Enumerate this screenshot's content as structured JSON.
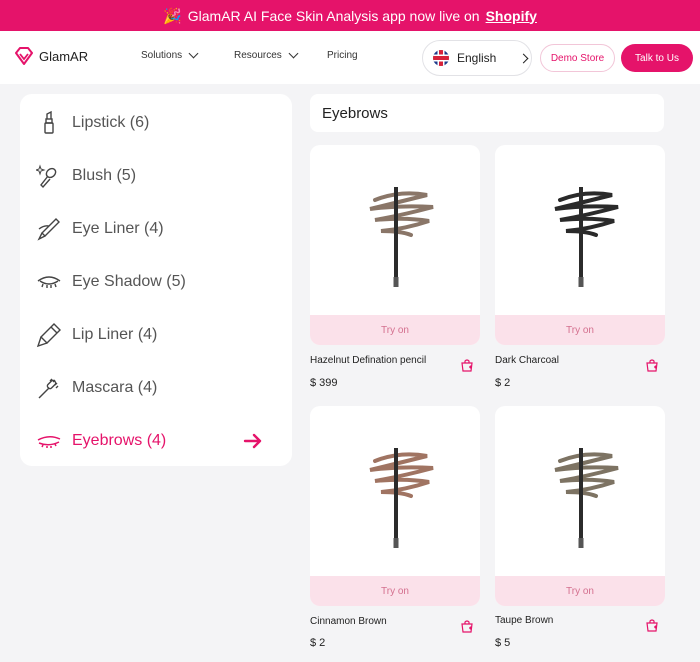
{
  "banner": {
    "text": "GlamAR AI Face Skin Analysis app now live on",
    "link": "Shopify",
    "icon": "party-popper-icon"
  },
  "nav": {
    "logo": "GlamAR",
    "solutions": "Solutions",
    "resources": "Resources",
    "pricing": "Pricing",
    "language": "English",
    "demo_store": "Demo Store",
    "talk": "Talk to Us"
  },
  "sidebar": {
    "items": [
      {
        "label": "Lipstick (6)",
        "icon": "lipstick-icon"
      },
      {
        "label": "Blush (5)",
        "icon": "blush-icon"
      },
      {
        "label": "Eye Liner (4)",
        "icon": "eyeliner-icon"
      },
      {
        "label": "Eye Shadow (5)",
        "icon": "eyeshadow-icon"
      },
      {
        "label": "Lip Liner (4)",
        "icon": "lipliner-icon"
      },
      {
        "label": "Mascara (4)",
        "icon": "mascara-icon"
      },
      {
        "label": "Eyebrows (4)",
        "icon": "eyebrow-icon",
        "active": true
      }
    ]
  },
  "main": {
    "heading": "Eyebrows",
    "try_label": "Try on",
    "products": [
      {
        "name": "Hazelnut Defination pencil",
        "price": "$ 399",
        "color": "#8a7668"
      },
      {
        "name": "Dark Charcoal",
        "price": "$ 2",
        "color": "#2a2a2a"
      },
      {
        "name": "Cinnamon Brown",
        "price": "$ 2",
        "color": "#a07462"
      },
      {
        "name": "Taupe Brown",
        "price": "$ 5",
        "color": "#7d7363"
      }
    ]
  },
  "colors": {
    "accent": "#e5136a",
    "try_bg": "#fbe1ea"
  }
}
